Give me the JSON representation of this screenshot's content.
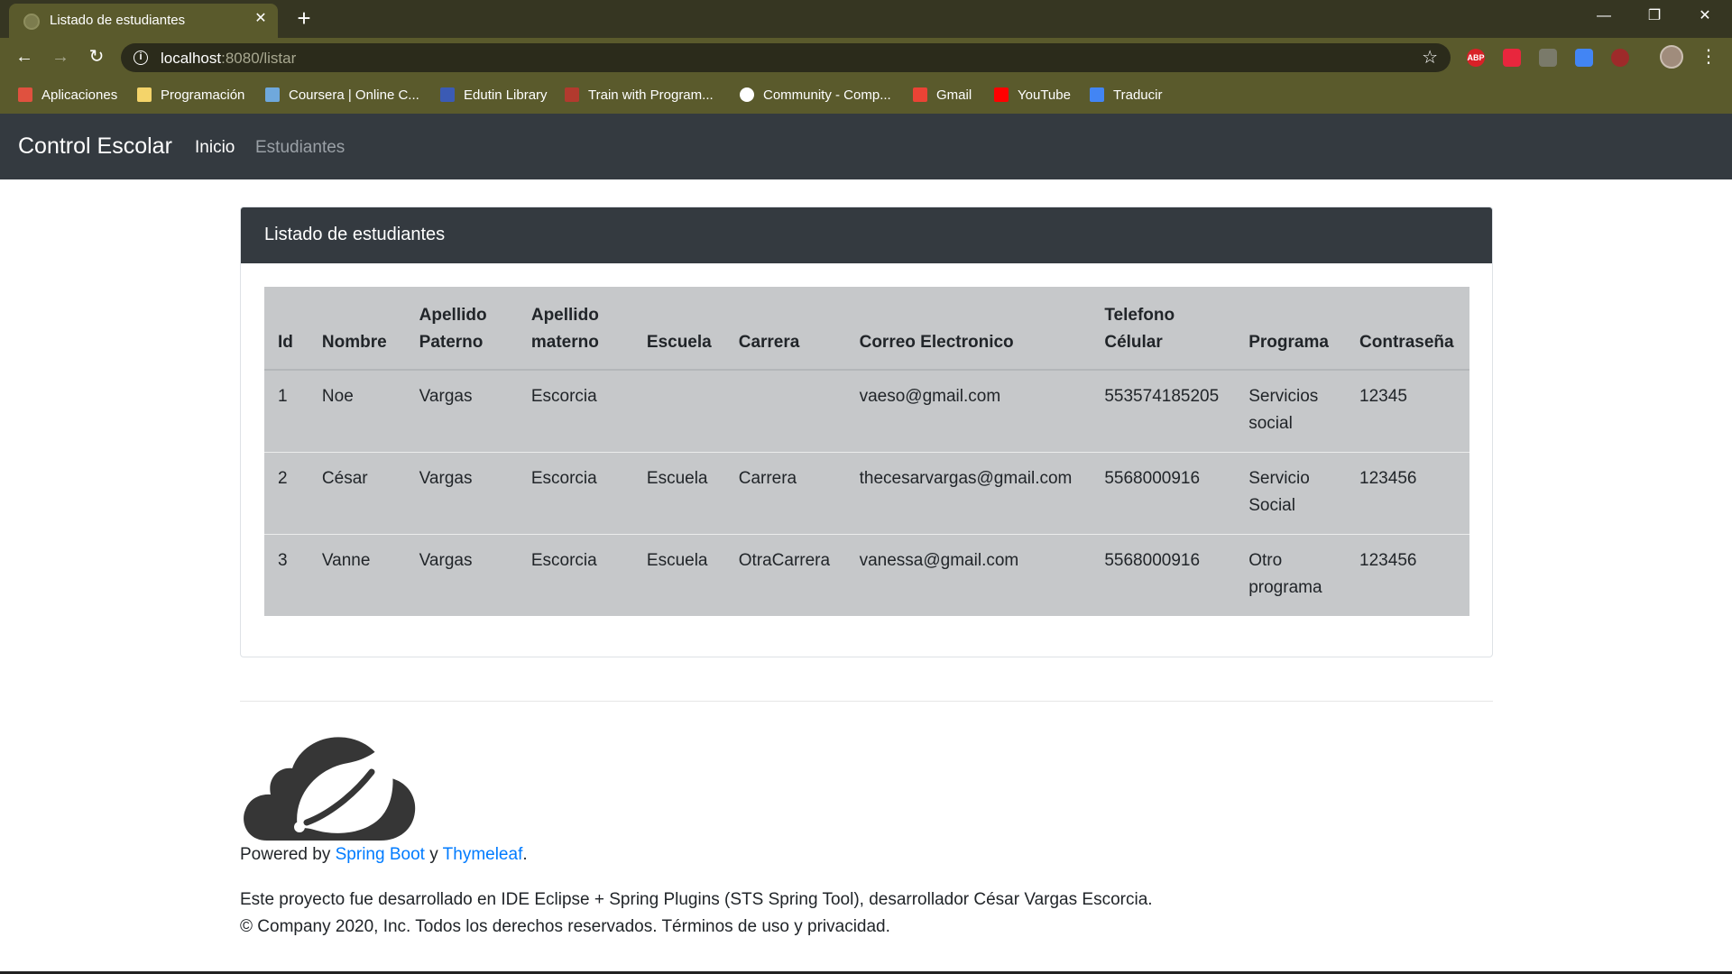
{
  "browser": {
    "tab_title": "Listado de estudiantes",
    "tab_close": "✕",
    "new_tab": "+",
    "url_host": "localhost",
    "url_rest": ":8080/listar",
    "window_controls": {
      "minimize": "—",
      "restore": "❐",
      "close": "✕"
    },
    "extensions": [
      {
        "icon": "adblock-plus-icon",
        "label": "ABP",
        "color": "#d92027"
      },
      {
        "icon": "pocket-icon",
        "label": "",
        "color": "#e8263d"
      },
      {
        "icon": "globe-icon",
        "label": "",
        "color": "#7a7a6a"
      },
      {
        "icon": "google-translate-icon",
        "label": "",
        "color": "#4285f4"
      },
      {
        "icon": "record-icon",
        "label": "",
        "color": "#9e2a2a"
      }
    ],
    "bookmarks": [
      {
        "label": "Aplicaciones",
        "icon": "apps-grid-icon",
        "color": "#e0513f"
      },
      {
        "label": "Programación",
        "icon": "folder-icon",
        "color": "#f4d46a"
      },
      {
        "label": "Coursera | Online C...",
        "icon": "coursera-icon",
        "color": "#6fa8dc"
      },
      {
        "label": "Edutin Library",
        "icon": "edutin-icon",
        "color": "#3b5bb5"
      },
      {
        "label": "Train with Program...",
        "icon": "train-icon",
        "color": "#b23a2e"
      },
      {
        "label": "Community - Comp...",
        "icon": "community-icon",
        "color": "#ffffff"
      },
      {
        "label": "Gmail",
        "icon": "gmail-icon",
        "color": "#ea4335"
      },
      {
        "label": "YouTube",
        "icon": "youtube-icon",
        "color": "#ff0000"
      },
      {
        "label": "Traducir",
        "icon": "translate-icon",
        "color": "#4285f4"
      }
    ]
  },
  "navbar": {
    "brand": "Control Escolar",
    "links": [
      {
        "label": "Inicio",
        "active": true
      },
      {
        "label": "Estudiantes",
        "active": false
      }
    ]
  },
  "card": {
    "title": "Listado de estudiantes",
    "table": {
      "headers": [
        "Id",
        "Nombre",
        "Apellido Paterno",
        "Apellido materno",
        "Escuela",
        "Carrera",
        "Correo Electronico",
        "Telefono Célular",
        "Programa",
        "Contraseña"
      ],
      "rows": [
        [
          "1",
          "Noe",
          "Vargas",
          "Escorcia",
          "",
          "",
          "vaeso@gmail.com",
          "553574185205",
          "Servicios social",
          "12345"
        ],
        [
          "2",
          "César",
          "Vargas",
          "Escorcia",
          "Escuela",
          "Carrera",
          "thecesarvargas@gmail.com",
          "5568000916",
          "Servicio Social",
          "123456"
        ],
        [
          "3",
          "Vanne",
          "Vargas",
          "Escorcia",
          "Escuela",
          "OtraCarrera",
          "vanessa@gmail.com",
          "5568000916",
          "Otro programa",
          "123456"
        ]
      ]
    }
  },
  "footer": {
    "powered_prefix": "Powered by ",
    "spring_boot": "Spring Boot",
    "powered_and": " y ",
    "thymeleaf": "Thymeleaf",
    "powered_suffix": ".",
    "line1": "Este proyecto fue desarrollado en IDE Eclipse + Spring Plugins (STS Spring Tool), desarrollador César Vargas Escorcia.",
    "line2": "© Company 2020, Inc. Todos los derechos reservados. Términos de uso y privacidad."
  },
  "colors": {
    "chrome_dark": "#363622",
    "chrome_olive": "#5a5a2c",
    "navbar": "#343a40",
    "table_bg": "#c6c8ca",
    "link": "#007bff",
    "nav_active": "#ffffff",
    "nav_inactive": "#9aa0a6"
  }
}
